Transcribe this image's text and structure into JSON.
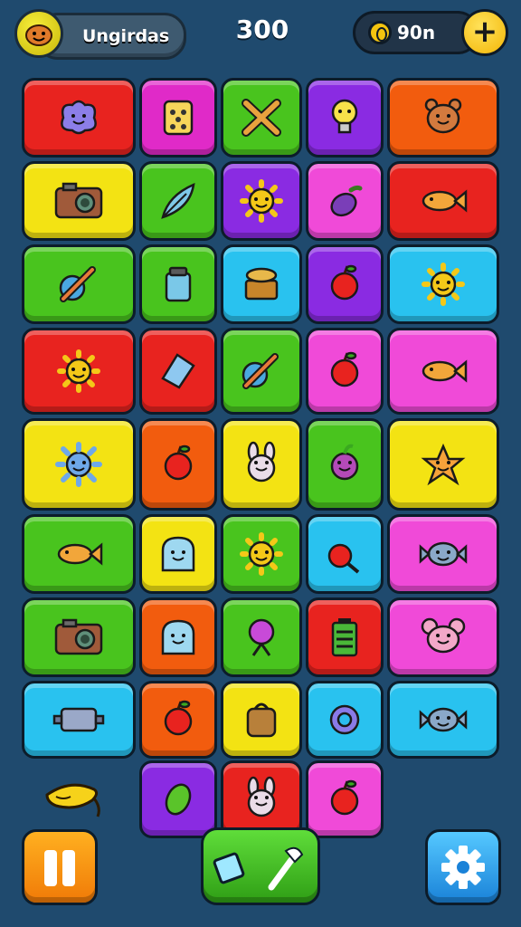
{
  "header": {
    "player_name": "Ungirdas",
    "avatar_icon": "smiley-face-icon",
    "score": "300",
    "coins": "90n",
    "coin_icon": "gold-coin-icon",
    "plus_label": "+"
  },
  "colors": {
    "background": "#1f4a6e",
    "red": "#e8231f",
    "magenta": "#e02ac8",
    "green": "#49c41e",
    "purple": "#8a2be2",
    "orange": "#f25c0e",
    "yellow": "#f3e313",
    "cyan": "#29c2ef",
    "pink": "#f04ad8",
    "dark_green": "#58c427",
    "orange2": "#f7761a"
  },
  "board": {
    "rows": [
      [
        {
          "color": "red",
          "icon": "purple-blob-icon"
        },
        {
          "color": "magenta",
          "icon": "dice-box-icon"
        },
        {
          "color": "green",
          "icon": "crossed-bones-icon"
        },
        {
          "color": "purple",
          "icon": "lightbulb-icon"
        },
        {
          "color": "orange",
          "icon": "bear-face-icon"
        }
      ],
      [
        {
          "color": "yellow",
          "icon": "camera-icon"
        },
        {
          "color": "green",
          "icon": "feather-icon"
        },
        {
          "color": "purple",
          "icon": "sun-icon"
        },
        {
          "color": "pink",
          "icon": "eggplant-icon"
        },
        {
          "color": "red",
          "icon": "fish-icon"
        }
      ],
      [
        {
          "color": "green",
          "icon": "pencil-icon"
        },
        {
          "color": "green",
          "icon": "jar-icon"
        },
        {
          "color": "cyan",
          "icon": "treasure-chest-icon"
        },
        {
          "color": "purple",
          "icon": "apple-icon"
        },
        {
          "color": "cyan",
          "icon": "sun-icon"
        }
      ],
      [
        {
          "color": "red",
          "icon": "sun-icon"
        },
        {
          "color": "red",
          "icon": "crystal-icon"
        },
        {
          "color": "green",
          "icon": "pencil-icon"
        },
        {
          "color": "pink",
          "icon": "apple-icon"
        },
        {
          "color": "pink",
          "icon": "fish-icon"
        }
      ],
      [
        {
          "color": "yellow",
          "icon": "virus-icon"
        },
        {
          "color": "orange",
          "icon": "apple-icon"
        },
        {
          "color": "yellow",
          "icon": "bunny-icon"
        },
        {
          "color": "green",
          "icon": "radish-icon"
        },
        {
          "color": "yellow",
          "icon": "starfish-icon"
        }
      ],
      [
        {
          "color": "green",
          "icon": "fish-icon"
        },
        {
          "color": "yellow",
          "icon": "ghost-icon"
        },
        {
          "color": "green",
          "icon": "sun-icon"
        },
        {
          "color": "cyan",
          "icon": "cherry-icon"
        },
        {
          "color": "pink",
          "icon": "candy-icon"
        }
      ],
      [
        {
          "color": "green",
          "icon": "camera-icon"
        },
        {
          "color": "orange",
          "icon": "ghost-icon"
        },
        {
          "color": "green",
          "icon": "balloon-icon"
        },
        {
          "color": "red",
          "icon": "battery-icon"
        },
        {
          "color": "pink",
          "icon": "mouse-face-icon"
        }
      ],
      [
        {
          "color": "cyan",
          "icon": "robot-icon"
        },
        {
          "color": "orange",
          "icon": "apple-icon"
        },
        {
          "color": "yellow",
          "icon": "backpack-icon"
        },
        {
          "color": "cyan",
          "icon": "gear-ring-icon"
        },
        {
          "color": "cyan",
          "icon": "candy-icon"
        }
      ],
      [
        null,
        {
          "color": "purple",
          "icon": "leaf-icon"
        },
        {
          "color": "red",
          "icon": "bunny-icon"
        },
        {
          "color": "pink",
          "icon": "apple-icon"
        },
        null
      ]
    ]
  },
  "footer": {
    "pause_icon": "pause-icon",
    "tools_icons": [
      "gem-icon",
      "hammer-icon"
    ],
    "settings_icon": "gear-icon",
    "decoration_icon": "banana-icon"
  }
}
